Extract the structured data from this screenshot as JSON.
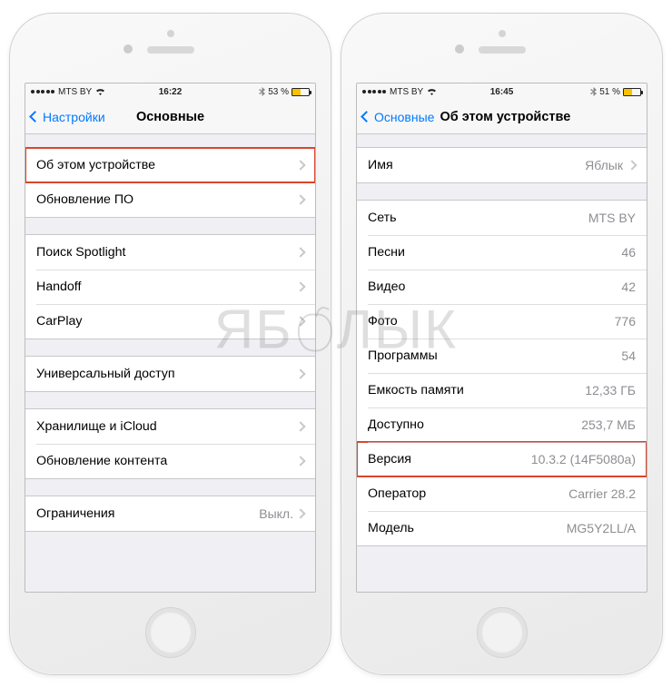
{
  "left": {
    "status": {
      "carrier": "MTS BY",
      "time": "16:22",
      "battery": "53 %"
    },
    "nav": {
      "back": "Настройки",
      "title": "Основные"
    },
    "groups": [
      [
        {
          "label": "Об этом устройстве",
          "disclosure": true,
          "highlight": true,
          "name": "row-about"
        },
        {
          "label": "Обновление ПО",
          "disclosure": true,
          "name": "row-software-update"
        }
      ],
      [
        {
          "label": "Поиск Spotlight",
          "disclosure": true,
          "name": "row-spotlight"
        },
        {
          "label": "Handoff",
          "disclosure": true,
          "name": "row-handoff"
        },
        {
          "label": "CarPlay",
          "disclosure": true,
          "name": "row-carplay"
        }
      ],
      [
        {
          "label": "Универсальный доступ",
          "disclosure": true,
          "name": "row-accessibility"
        }
      ],
      [
        {
          "label": "Хранилище и iCloud",
          "disclosure": true,
          "name": "row-storage-icloud"
        },
        {
          "label": "Обновление контента",
          "disclosure": true,
          "name": "row-background-refresh"
        }
      ],
      [
        {
          "label": "Ограничения",
          "value": "Выкл.",
          "disclosure": true,
          "name": "row-restrictions"
        }
      ]
    ]
  },
  "right": {
    "status": {
      "carrier": "MTS BY",
      "time": "16:45",
      "battery": "51 %"
    },
    "nav": {
      "back": "Основные",
      "title": "Об этом устройстве"
    },
    "rows": [
      {
        "label": "Имя",
        "value": "Яблык",
        "disclosure": true,
        "name": "row-name",
        "group": 0
      },
      {
        "label": "Сеть",
        "value": "MTS BY",
        "name": "row-network",
        "group": 1
      },
      {
        "label": "Песни",
        "value": "46",
        "name": "row-songs",
        "group": 1
      },
      {
        "label": "Видео",
        "value": "42",
        "name": "row-videos",
        "group": 1
      },
      {
        "label": "Фото",
        "value": "776",
        "name": "row-photos",
        "group": 1
      },
      {
        "label": "Программы",
        "value": "54",
        "name": "row-apps",
        "group": 1
      },
      {
        "label": "Емкость памяти",
        "value": "12,33 ГБ",
        "name": "row-capacity",
        "group": 1
      },
      {
        "label": "Доступно",
        "value": "253,7 МБ",
        "name": "row-available",
        "group": 1
      },
      {
        "label": "Версия",
        "value": "10.3.2 (14F5080a)",
        "highlight": true,
        "name": "row-version",
        "group": 1
      },
      {
        "label": "Оператор",
        "value": "Carrier 28.2",
        "name": "row-carrier",
        "group": 1
      },
      {
        "label": "Модель",
        "value": "MG5Y2LL/A",
        "name": "row-model",
        "group": 1
      }
    ]
  },
  "watermark": {
    "left_text": "ЯБ",
    "right_text": "ЛЫК"
  }
}
